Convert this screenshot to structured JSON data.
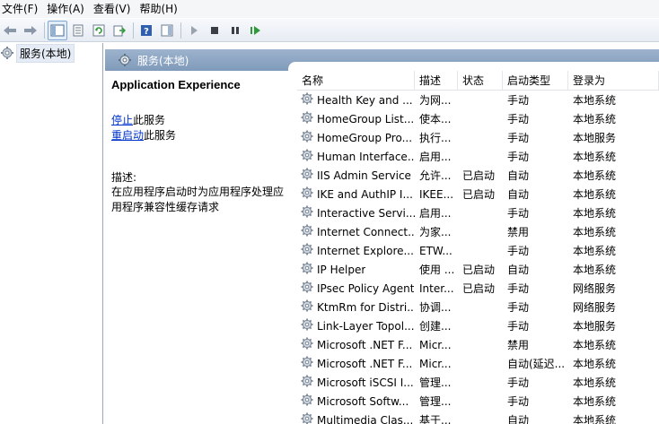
{
  "menu": [
    "文件(F)",
    "操作(A)",
    "查看(V)",
    "帮助(H)"
  ],
  "tree": {
    "root_label": "服务(本地)"
  },
  "header": {
    "title": "服务(本地)"
  },
  "details": {
    "service_name": "Application Experience",
    "stop_link": "停止",
    "stop_suffix": "此服务",
    "restart_link": "重启动",
    "restart_suffix": "此服务",
    "description_label": "描述:",
    "description_text": "在应用程序启动时为应用程序处理应用程序兼容性缓存请求"
  },
  "table": {
    "columns": [
      "名称",
      "描述",
      "状态",
      "启动类型",
      "登录为"
    ],
    "rows": [
      {
        "name": "Health Key and ...",
        "desc": "为网...",
        "status": "",
        "startup": "手动",
        "logon": "本地系统"
      },
      {
        "name": "HomeGroup List...",
        "desc": "使本...",
        "status": "",
        "startup": "手动",
        "logon": "本地系统"
      },
      {
        "name": "HomeGroup Pro...",
        "desc": "执行...",
        "status": "",
        "startup": "手动",
        "logon": "本地服务"
      },
      {
        "name": "Human Interface...",
        "desc": "启用...",
        "status": "",
        "startup": "手动",
        "logon": "本地系统"
      },
      {
        "name": "IIS Admin Service",
        "desc": "允许...",
        "status": "已启动",
        "startup": "自动",
        "logon": "本地系统"
      },
      {
        "name": "IKE and AuthIP I...",
        "desc": "IKEE...",
        "status": "已启动",
        "startup": "自动",
        "logon": "本地系统"
      },
      {
        "name": "Interactive Servi...",
        "desc": "启用...",
        "status": "",
        "startup": "手动",
        "logon": "本地系统"
      },
      {
        "name": "Internet Connect...",
        "desc": "为家...",
        "status": "",
        "startup": "禁用",
        "logon": "本地系统"
      },
      {
        "name": "Internet Explore...",
        "desc": "ETW...",
        "status": "",
        "startup": "手动",
        "logon": "本地系统"
      },
      {
        "name": "IP Helper",
        "desc": "使用 ...",
        "status": "已启动",
        "startup": "自动",
        "logon": "本地系统"
      },
      {
        "name": "IPsec Policy Agent",
        "desc": "Inter...",
        "status": "已启动",
        "startup": "手动",
        "logon": "网络服务"
      },
      {
        "name": "KtmRm for Distri...",
        "desc": "协调...",
        "status": "",
        "startup": "手动",
        "logon": "网络服务"
      },
      {
        "name": "Link-Layer Topol...",
        "desc": "创建...",
        "status": "",
        "startup": "手动",
        "logon": "本地服务"
      },
      {
        "name": "Microsoft .NET F...",
        "desc": "Micr...",
        "status": "",
        "startup": "禁用",
        "logon": "本地系统"
      },
      {
        "name": "Microsoft .NET F...",
        "desc": "Micr...",
        "status": "",
        "startup": "自动(延迟...",
        "logon": "本地系统"
      },
      {
        "name": "Microsoft iSCSI I...",
        "desc": "管理...",
        "status": "",
        "startup": "手动",
        "logon": "本地系统"
      },
      {
        "name": "Microsoft Softw...",
        "desc": "管理...",
        "status": "",
        "startup": "手动",
        "logon": "本地系统"
      },
      {
        "name": "Multimedia Clas...",
        "desc": "基于...",
        "status": "",
        "startup": "自动",
        "logon": "本地系统"
      }
    ]
  },
  "icons": {
    "toolbar": [
      "back-arrow-icon",
      "forward-arrow-icon",
      "show-hide-tree-icon",
      "properties-icon",
      "refresh-icon",
      "export-list-icon",
      "help-icon",
      "view-pane-icon",
      "play-icon",
      "stop-icon",
      "pause-icon",
      "resume-icon"
    ],
    "service": "gear-icon"
  }
}
